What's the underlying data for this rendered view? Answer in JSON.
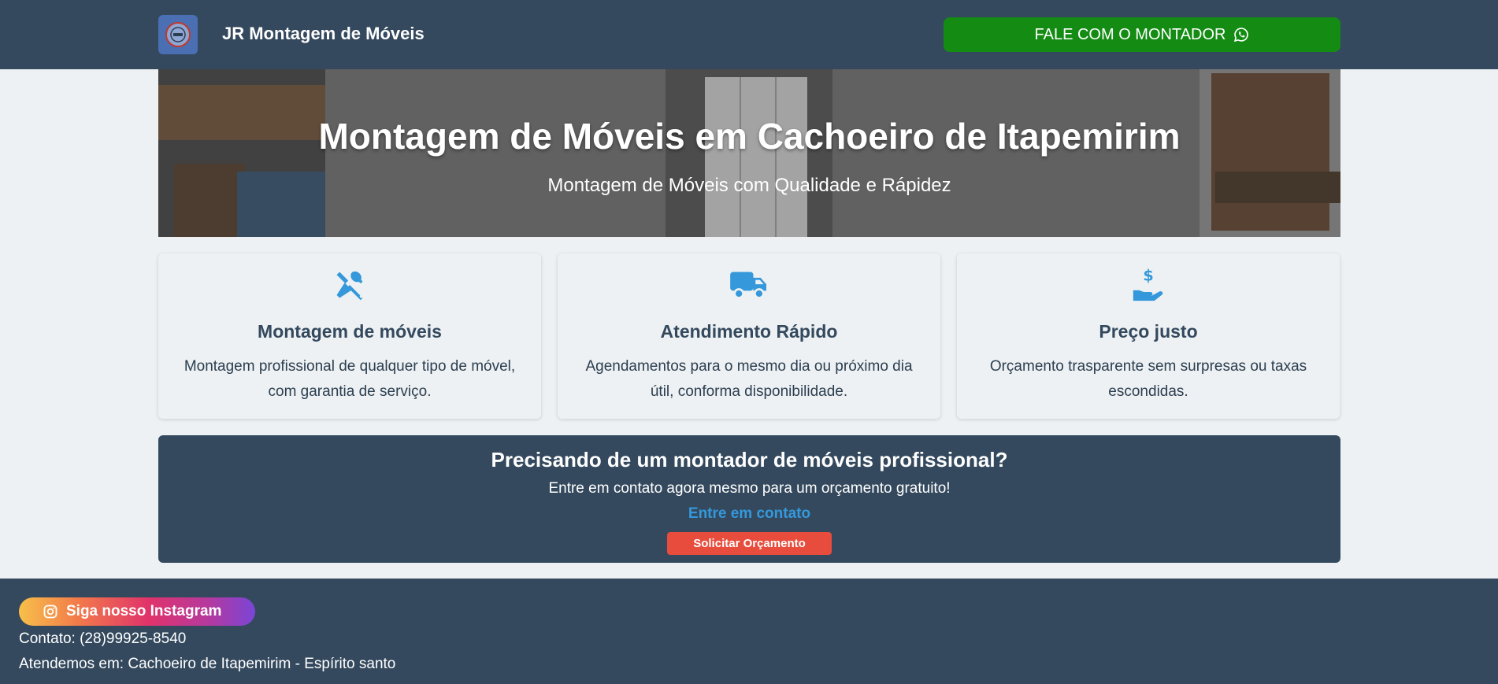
{
  "header": {
    "brand": "JR Montagem de Móveis",
    "cta_label": "FALE COM O MONTADOR",
    "cta_icon": "whatsapp-icon",
    "bg_color": "#34495e",
    "cta_color": "#148c14"
  },
  "hero": {
    "title": "Montagem de Móveis em Cachoeiro de Itapemirim",
    "subtitle": "Montagem de Móveis com Qualidade e Rápidez"
  },
  "features": [
    {
      "icon": "tools-icon",
      "title": "Montagem de móveis",
      "text": "Montagem profissional de qualquer tipo de móvel, com garantia de serviço."
    },
    {
      "icon": "truck-icon",
      "title": "Atendimento Rápido",
      "text": "Agendamentos para o mesmo dia ou próximo dia útil, conforma disponibilidade."
    },
    {
      "icon": "hand-dollar-icon",
      "title": "Preço justo",
      "text": "Orçamento trasparente sem surpresas ou taxas escondidas."
    }
  ],
  "cta": {
    "title": "Precisando de um montador de móveis profissional?",
    "text": "Entre em contato agora mesmo para um orçamento gratuito!",
    "link": "Entre em contato",
    "button": "Solicitar Orçamento",
    "button_color": "#e74c3c",
    "link_color": "#3498db"
  },
  "footer": {
    "instagram_label": "Siga nosso Instagram",
    "contact": "Contato: (28)99925-8540",
    "area": "Atendemos em: Cachoeiro de Itapemirim - Espírito santo"
  },
  "colors": {
    "accent_icon": "#3498db",
    "page_bg": "#edf1f3"
  }
}
